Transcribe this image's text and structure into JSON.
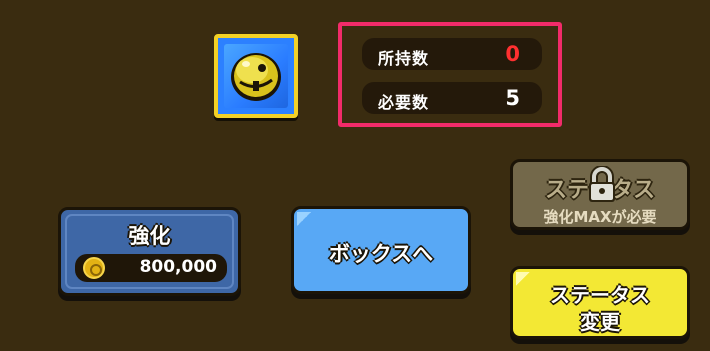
{
  "item": {
    "icon": "golden-bell-icon"
  },
  "counts": {
    "owned_label": "所持数",
    "owned_value": "0",
    "required_label": "必要数",
    "required_value": "5"
  },
  "enhance": {
    "label": "強化",
    "cost": "800,000",
    "cost_icon": "coin-icon"
  },
  "box_button": {
    "label": "ボックスへ"
  },
  "status_locked": {
    "label": "ステータス",
    "note": "強化MAXが必要",
    "icon": "lock-icon"
  },
  "status_change": {
    "line1": "ステータス",
    "line2": "変更"
  },
  "colors": {
    "background": "#3a2c10",
    "highlight_border": "#f22b6a",
    "owned_value": "#ff3030",
    "box_button": "#58a8f5",
    "enhance_button": "#3e67a6",
    "status_change_button": "#f3e834",
    "status_locked_button": "#73684a"
  }
}
